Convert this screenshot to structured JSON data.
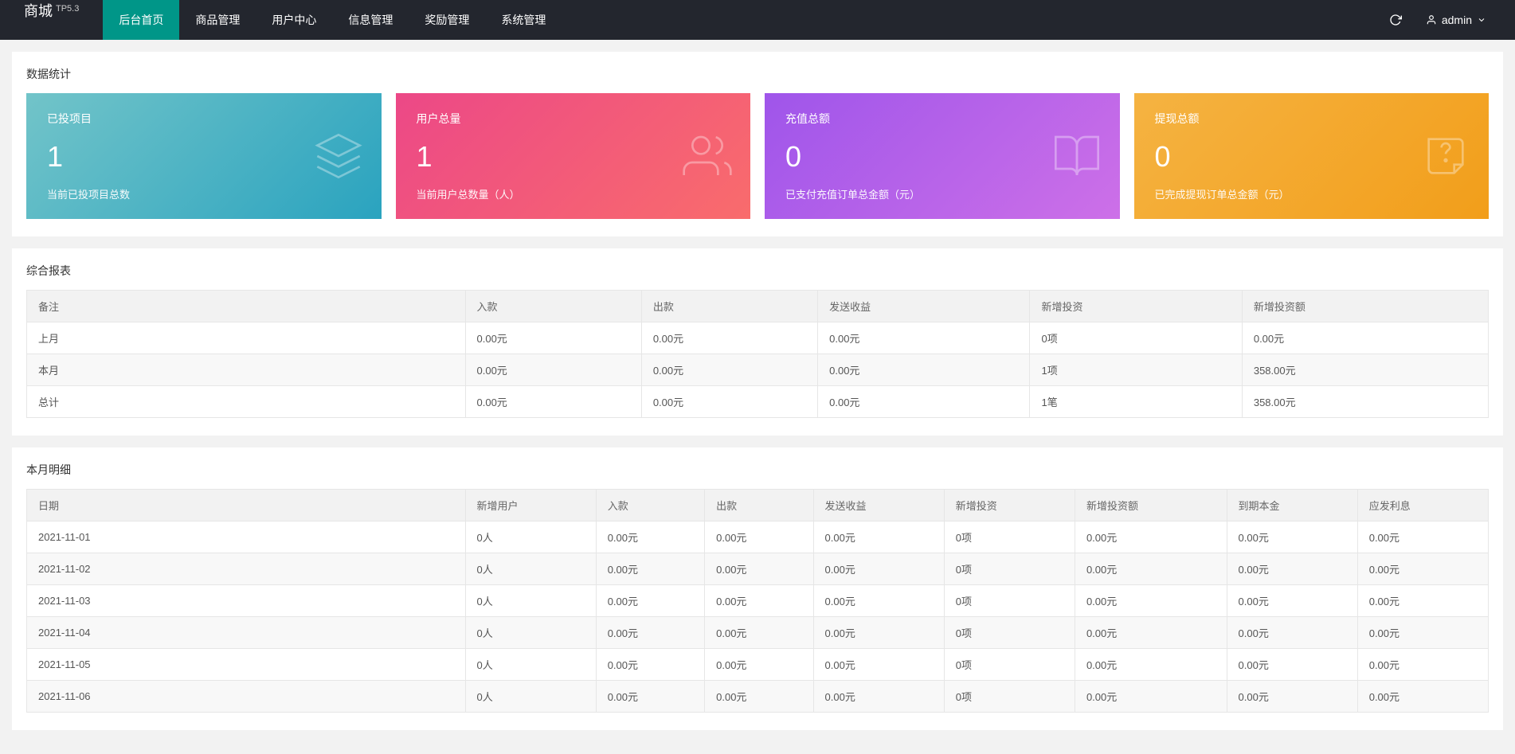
{
  "brand": {
    "name": "商城",
    "version": "TP5.3"
  },
  "nav": [
    {
      "label": "后台首页",
      "active": true
    },
    {
      "label": "商品管理"
    },
    {
      "label": "用户中心"
    },
    {
      "label": "信息管理"
    },
    {
      "label": "奖励管理"
    },
    {
      "label": "系统管理"
    }
  ],
  "user": {
    "name": "admin"
  },
  "stats": {
    "title": "数据统计",
    "cards": [
      {
        "label": "已投项目",
        "value": "1",
        "desc": "当前已投项目总数"
      },
      {
        "label": "用户总量",
        "value": "1",
        "desc": "当前用户总数量（人）"
      },
      {
        "label": "充值总额",
        "value": "0",
        "desc": "已支付充值订单总金额（元）"
      },
      {
        "label": "提现总额",
        "value": "0",
        "desc": "已完成提现订单总金额（元）"
      }
    ]
  },
  "summary": {
    "title": "综合报表",
    "headers": [
      "备注",
      "入款",
      "出款",
      "发送收益",
      "新增投资",
      "新增投资额"
    ],
    "rows": [
      [
        "上月",
        "0.00元",
        "0.00元",
        "0.00元",
        "0项",
        "0.00元"
      ],
      [
        "本月",
        "0.00元",
        "0.00元",
        "0.00元",
        "1项",
        "358.00元"
      ],
      [
        "总计",
        "0.00元",
        "0.00元",
        "0.00元",
        "1笔",
        "358.00元"
      ]
    ]
  },
  "detail": {
    "title": "本月明细",
    "headers": [
      "日期",
      "新增用户",
      "入款",
      "出款",
      "发送收益",
      "新增投资",
      "新增投资额",
      "到期本金",
      "应发利息"
    ],
    "rows": [
      [
        "2021-11-01",
        "0人",
        "0.00元",
        "0.00元",
        "0.00元",
        "0项",
        "0.00元",
        "0.00元",
        "0.00元"
      ],
      [
        "2021-11-02",
        "0人",
        "0.00元",
        "0.00元",
        "0.00元",
        "0项",
        "0.00元",
        "0.00元",
        "0.00元"
      ],
      [
        "2021-11-03",
        "0人",
        "0.00元",
        "0.00元",
        "0.00元",
        "0项",
        "0.00元",
        "0.00元",
        "0.00元"
      ],
      [
        "2021-11-04",
        "0人",
        "0.00元",
        "0.00元",
        "0.00元",
        "0项",
        "0.00元",
        "0.00元",
        "0.00元"
      ],
      [
        "2021-11-05",
        "0人",
        "0.00元",
        "0.00元",
        "0.00元",
        "0项",
        "0.00元",
        "0.00元",
        "0.00元"
      ],
      [
        "2021-11-06",
        "0人",
        "0.00元",
        "0.00元",
        "0.00元",
        "0项",
        "0.00元",
        "0.00元",
        "0.00元"
      ]
    ]
  }
}
